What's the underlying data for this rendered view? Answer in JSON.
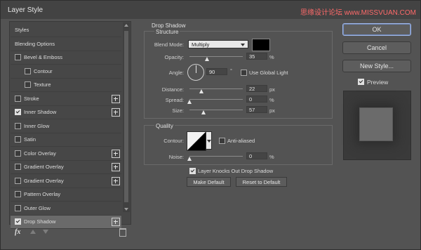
{
  "window": {
    "title": "Layer Style",
    "watermark": "思缘设计论坛 www.MISSVUAN.COM"
  },
  "sidebar": {
    "items": [
      {
        "label": "Styles",
        "checkbox": null,
        "plus": false,
        "indent": 0,
        "selected": false
      },
      {
        "label": "Blending Options",
        "checkbox": null,
        "plus": false,
        "indent": 0,
        "selected": false
      },
      {
        "label": "Bevel & Emboss",
        "checkbox": false,
        "plus": false,
        "indent": 0,
        "selected": false
      },
      {
        "label": "Contour",
        "checkbox": false,
        "plus": false,
        "indent": 1,
        "selected": false
      },
      {
        "label": "Texture",
        "checkbox": false,
        "plus": false,
        "indent": 1,
        "selected": false
      },
      {
        "label": "Stroke",
        "checkbox": false,
        "plus": true,
        "indent": 0,
        "selected": false
      },
      {
        "label": "Inner Shadow",
        "checkbox": true,
        "plus": true,
        "indent": 0,
        "selected": false
      },
      {
        "label": "Inner Glow",
        "checkbox": false,
        "plus": false,
        "indent": 0,
        "selected": false
      },
      {
        "label": "Satin",
        "checkbox": false,
        "plus": false,
        "indent": 0,
        "selected": false
      },
      {
        "label": "Color Overlay",
        "checkbox": false,
        "plus": true,
        "indent": 0,
        "selected": false
      },
      {
        "label": "Gradient Overlay",
        "checkbox": false,
        "plus": true,
        "indent": 0,
        "selected": false
      },
      {
        "label": "Gradient Overlay",
        "checkbox": false,
        "plus": true,
        "indent": 0,
        "selected": false
      },
      {
        "label": "Pattern Overlay",
        "checkbox": false,
        "plus": false,
        "indent": 0,
        "selected": false
      },
      {
        "label": "Outer Glow",
        "checkbox": false,
        "plus": false,
        "indent": 0,
        "selected": false
      },
      {
        "label": "Drop Shadow",
        "checkbox": true,
        "plus": true,
        "indent": 0,
        "selected": true
      }
    ],
    "bottom": {
      "fx_label": "fx"
    }
  },
  "drop_shadow": {
    "title": "Drop Shadow",
    "structure": {
      "title": "Structure",
      "blend_mode_label": "Blend Mode:",
      "blend_mode_value": "Multiply",
      "shadow_color": "#000000",
      "opacity_label": "Opacity:",
      "opacity_value": "35",
      "opacity_unit": "%",
      "angle_label": "Angle:",
      "angle_value": "90",
      "angle_unit": "°",
      "use_global_light_label": "Use Global Light",
      "use_global_light": false,
      "distance_label": "Distance:",
      "distance_value": "22",
      "distance_unit": "px",
      "spread_label": "Spread:",
      "spread_value": "0",
      "spread_unit": "%",
      "size_label": "Size:",
      "size_value": "57",
      "size_unit": "px"
    },
    "quality": {
      "title": "Quality",
      "contour_label": "Contour:",
      "anti_aliased_label": "Anti-aliased",
      "anti_aliased": false,
      "noise_label": "Noise:",
      "noise_value": "0",
      "noise_unit": "%"
    },
    "layer_knocks_out_label": "Layer Knocks Out Drop Shadow",
    "layer_knocks_out": true,
    "make_default_label": "Make Default",
    "reset_default_label": "Reset to Default"
  },
  "actions": {
    "ok_label": "OK",
    "cancel_label": "Cancel",
    "new_style_label": "New Style...",
    "preview_label": "Preview",
    "preview_checked": true
  }
}
